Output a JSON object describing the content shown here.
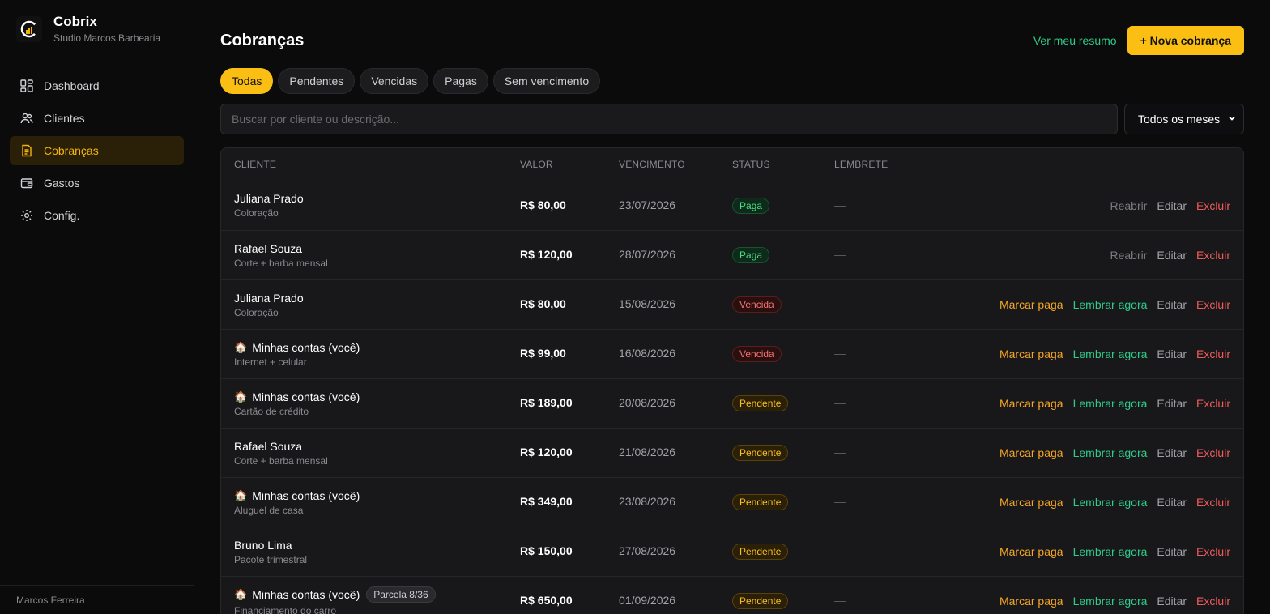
{
  "app": {
    "name": "Cobrix",
    "subtitle": "Studio Marcos Barbearia",
    "user": "Marcos Ferreira"
  },
  "sidebar": {
    "items": [
      {
        "label": "Dashboard",
        "icon": "dashboard-icon"
      },
      {
        "label": "Clientes",
        "icon": "users-icon"
      },
      {
        "label": "Cobranças",
        "icon": "document-icon",
        "active": true
      },
      {
        "label": "Gastos",
        "icon": "wallet-icon"
      },
      {
        "label": "Config.",
        "icon": "gear-icon"
      }
    ]
  },
  "header": {
    "title": "Cobranças",
    "summary_link": "Ver meu resumo",
    "new_button": "+ Nova cobrança"
  },
  "tabs": [
    "Todas",
    "Pendentes",
    "Vencidas",
    "Pagas",
    "Sem vencimento"
  ],
  "active_tab": "Todas",
  "search": {
    "placeholder": "Buscar por cliente ou descrição..."
  },
  "month_filter": {
    "selected": "Todos os meses"
  },
  "table": {
    "headers": {
      "client": "CLIENTE",
      "value": "VALOR",
      "due": "VENCIMENTO",
      "status": "STATUS",
      "reminder": "LEMBRETE"
    },
    "actions": {
      "reopen": "Reabrir",
      "edit": "Editar",
      "delete": "Excluir",
      "mark_paid": "Marcar paga",
      "remind": "Lembrar agora"
    },
    "rows": [
      {
        "client": "Juliana Prado",
        "desc": "Coloração",
        "value": "R$ 80,00",
        "due": "23/07/2026",
        "status": "Paga",
        "reminder": "—"
      },
      {
        "client": "Rafael Souza",
        "desc": "Corte + barba mensal",
        "value": "R$ 120,00",
        "due": "28/07/2026",
        "status": "Paga",
        "reminder": "—"
      },
      {
        "client": "Juliana Prado",
        "desc": "Coloração",
        "value": "R$ 80,00",
        "due": "15/08/2026",
        "status": "Vencida",
        "reminder": "—"
      },
      {
        "client": "Minhas contas (você)",
        "own": true,
        "desc": "Internet + celular",
        "value": "R$ 99,00",
        "due": "16/08/2026",
        "status": "Vencida",
        "reminder": "—"
      },
      {
        "client": "Minhas contas (você)",
        "own": true,
        "desc": "Cartão de crédito",
        "value": "R$ 189,00",
        "due": "20/08/2026",
        "status": "Pendente",
        "reminder": "—"
      },
      {
        "client": "Rafael Souza",
        "desc": "Corte + barba mensal",
        "value": "R$ 120,00",
        "due": "21/08/2026",
        "status": "Pendente",
        "reminder": "—"
      },
      {
        "client": "Minhas contas (você)",
        "own": true,
        "desc": "Aluguel de casa",
        "value": "R$ 349,00",
        "due": "23/08/2026",
        "status": "Pendente",
        "reminder": "—"
      },
      {
        "client": "Bruno Lima",
        "desc": "Pacote trimestral",
        "value": "R$ 150,00",
        "due": "27/08/2026",
        "status": "Pendente",
        "reminder": "—"
      },
      {
        "client": "Minhas contas (você)",
        "own": true,
        "parcel": "Parcela 8/36",
        "desc": "Financiamento do carro",
        "value": "R$ 650,00",
        "due": "01/09/2026",
        "status": "Pendente",
        "reminder": "—"
      }
    ]
  },
  "colors": {
    "accent": "#fbbf14",
    "green": "#2ecc8a",
    "red": "#f15b5b",
    "bg": "#0b0b0c",
    "panel": "#18181b"
  }
}
